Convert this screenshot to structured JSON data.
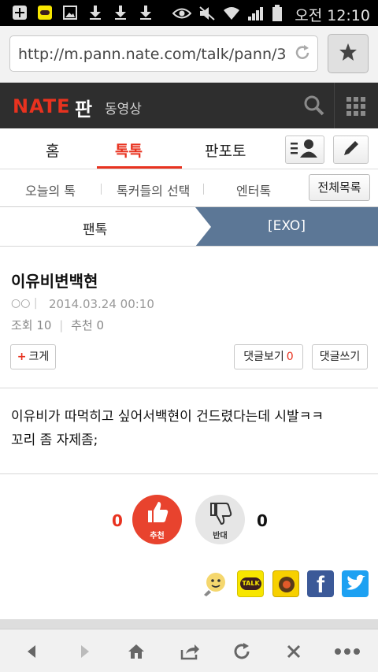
{
  "status_bar": {
    "left_icons": [
      "add-notification-icon",
      "kakaotalk-notification-icon",
      "image-notification-icon",
      "download-icon",
      "download-icon",
      "download-icon"
    ],
    "right_icons": [
      "eye-icon",
      "mute-icon",
      "wifi-icon",
      "signal-icon",
      "battery-icon"
    ],
    "time": "오전 12:10"
  },
  "browser": {
    "url": "http://m.pann.nate.com/talk/pann/3",
    "reload_icon": "reload-icon",
    "favorite_icon": "star-icon"
  },
  "header": {
    "logo_nate": "NATE",
    "logo_pan": "판",
    "video": "동영상"
  },
  "tabs": {
    "items": [
      {
        "label": "홈"
      },
      {
        "label": "톡톡"
      },
      {
        "label": "판포토"
      }
    ],
    "active": "톡톡"
  },
  "subnav": {
    "items": [
      {
        "label": "오늘의 톡"
      },
      {
        "label": "톡커들의 선택"
      },
      {
        "label": "엔터톡"
      }
    ],
    "all_button": "전체목록"
  },
  "board": {
    "left": "팬톡",
    "right": "[EXO]"
  },
  "post": {
    "title": "이유비변백현",
    "author": "○○",
    "date": "2014.03.24 00:10",
    "views_label": "조회",
    "views": "10",
    "recommend_label": "추천",
    "recommend": "0",
    "bigger_button": "크게",
    "comments_view_label": "댓글보기",
    "comments_count": "0",
    "comments_write_label": "댓글쓰기",
    "body_line1": "이유비가 따먹히고 싶어서백현이 건드렸다는데 시발ㅋㅋ",
    "body_line2": "꼬리 좀 자제좀;"
  },
  "votes": {
    "up_count": "0",
    "up_label": "추천",
    "down_count": "0",
    "down_label": "반대"
  },
  "share": {
    "icons": [
      "emoticon-share-icon",
      "kakaotalk-share-icon",
      "kakaostory-share-icon",
      "facebook-share-icon",
      "twitter-share-icon"
    ],
    "kakaotalk_text": "TALK",
    "facebook_text": "f"
  },
  "colors": {
    "accent": "#e8321f",
    "header_bg": "#2e2e2e",
    "board_active_bg": "#5c7796",
    "facebook": "#3b5998",
    "twitter": "#1da1f2",
    "kakao": "#f7e600"
  }
}
